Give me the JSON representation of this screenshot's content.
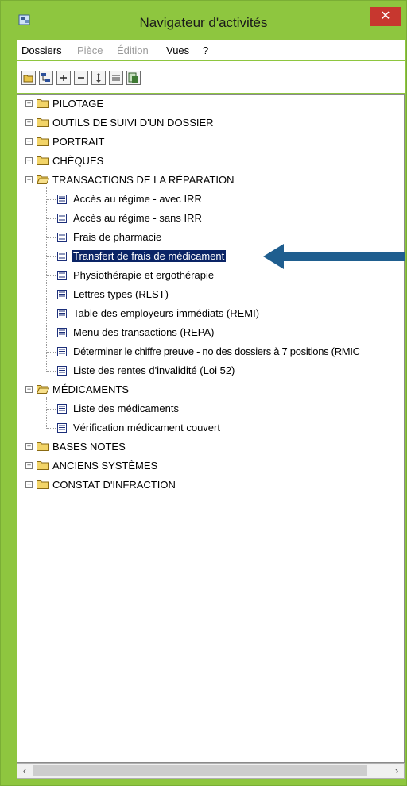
{
  "window": {
    "title": "Navigateur d'activités",
    "close_glyph": "✕"
  },
  "menu": [
    {
      "label": "Dossiers",
      "enabled": true
    },
    {
      "label": "Pièce",
      "enabled": false
    },
    {
      "label": "Édition",
      "enabled": false
    },
    {
      "label": "Vues",
      "enabled": true
    },
    {
      "label": "?",
      "enabled": true
    }
  ],
  "toolbar": [
    "open-folder-icon",
    "tree-view-icon",
    "expand-plus-icon",
    "collapse-minus-icon",
    "move-icon",
    "list-icon",
    "export-icon"
  ],
  "tree": {
    "pilotage": "PILOTAGE",
    "outils": "OUTILS DE SUIVI D'UN DOSSIER",
    "portrait": "PORTRAIT",
    "cheques": "CHÈQUES",
    "transactions": "TRANSACTIONS DE LA RÉPARATION",
    "t_items": [
      "Accès au régime - avec IRR",
      "Accès au régime - sans IRR",
      "Frais de pharmacie",
      "Transfert de frais de médicament",
      "Physiothérapie et ergothérapie",
      "Lettres types (RLST)",
      "Table des employeurs immédiats (REMI)",
      "Menu des transactions (REPA)",
      "Déterminer le chiffre preuve - no des dossiers à 7 positions (RMIC",
      "Liste des rentes d'invalidité (Loi 52)"
    ],
    "medicaments": "MÉDICAMENTS",
    "m_items": [
      "Liste des médicaments",
      "Vérification médicament couvert"
    ],
    "bases": "BASES NOTES",
    "anciens": "ANCIENS SYSTÈMES",
    "constat": "CONSTAT D'INFRACTION",
    "selected": "Transfert de frais de médicament"
  },
  "scrollbar": {
    "left": "‹",
    "right": "›"
  },
  "colors": {
    "frame": "#8ec63f",
    "selection": "#0a2466",
    "pointer_arrow": "#1f5e8f",
    "close": "#c7372f"
  }
}
